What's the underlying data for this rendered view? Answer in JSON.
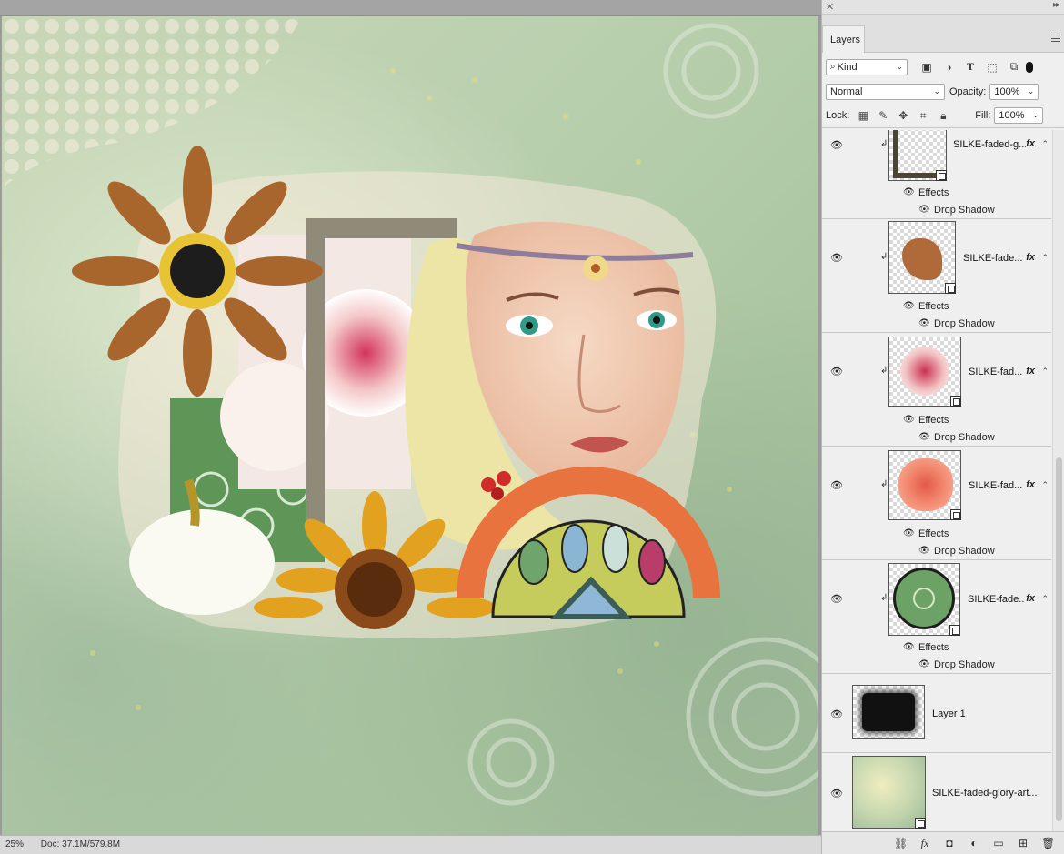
{
  "canvas": {
    "status": {
      "zoom": "25%",
      "doc": "Doc: 37.1M/579.8M"
    }
  },
  "panel": {
    "tab_label": "Layers",
    "filter": {
      "kind_label": "Kind"
    },
    "blend": {
      "mode": "Normal",
      "opacity_label": "Opacity:",
      "opacity_value": "100%"
    },
    "lock": {
      "label": "Lock:",
      "fill_label": "Fill:",
      "fill_value": "100%"
    },
    "layers": [
      {
        "name": "SILKE-faded-g...",
        "fx": "fx",
        "effects_label": "Effects",
        "effect": "Drop Shadow"
      },
      {
        "name": "SILKE-fade...",
        "fx": "fx",
        "effects_label": "Effects",
        "effect": "Drop Shadow"
      },
      {
        "name": "SILKE-fad...",
        "fx": "fx",
        "effects_label": "Effects",
        "effect": "Drop Shadow"
      },
      {
        "name": "SILKE-fad...",
        "fx": "fx",
        "effects_label": "Effects",
        "effect": "Drop Shadow"
      },
      {
        "name": "SILKE-fade...",
        "fx": "fx",
        "effects_label": "Effects",
        "effect": "Drop Shadow"
      },
      {
        "name": "Layer 1"
      },
      {
        "name": "SILKE-faded-glory-art..."
      }
    ]
  },
  "colors": {
    "panel_bg": "#efefef",
    "canvas_bg": "#9b9b9b",
    "orange": "#e8733f",
    "sunflower": "#e2a11e"
  }
}
